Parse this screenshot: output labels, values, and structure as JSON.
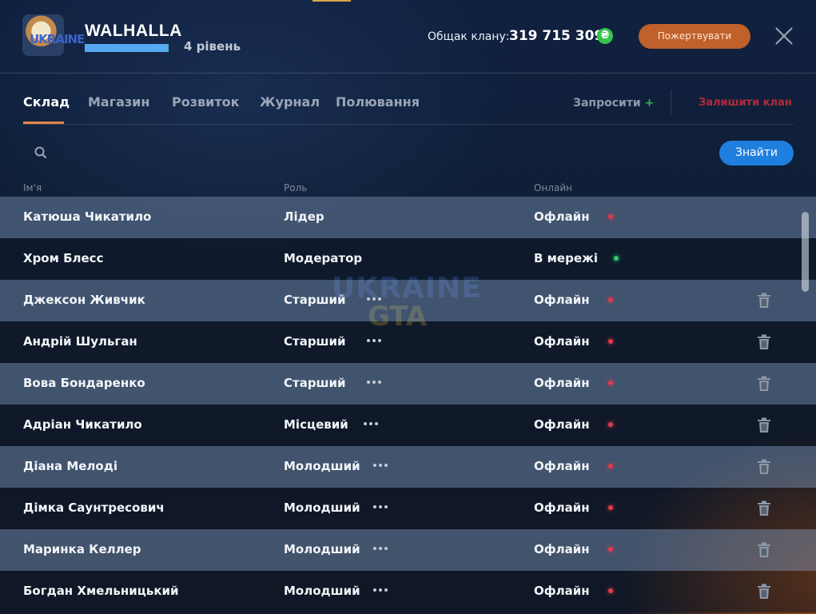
{
  "header": {
    "clan_name": "WALHALLA",
    "level_text": "4 рівень",
    "level_progress_percent": 94,
    "bank_label": "Общак клану:",
    "bank_value": "319 715 309",
    "currency_symbol": "₴",
    "donate_label": "Пожертвувати"
  },
  "tabs": [
    {
      "label": "Склад",
      "active": true
    },
    {
      "label": "Магазин",
      "active": false
    },
    {
      "label": "Розвиток",
      "active": false
    },
    {
      "label": "Журнал",
      "active": false
    },
    {
      "label": "Полювання",
      "active": false
    }
  ],
  "actions": {
    "invite_label": "Запросити",
    "invite_plus": "+",
    "leave_label": "Залишити клан"
  },
  "search": {
    "placeholder": "",
    "button_label": "Знайти"
  },
  "columns": {
    "name": "Ім'я",
    "role": "Роль",
    "online": "Онлайн"
  },
  "members": [
    {
      "name": "Катюша Чикатило",
      "role": "Лідер",
      "status": "Офлайн",
      "online": false,
      "has_menu": false,
      "removable": false
    },
    {
      "name": "Хром Блесс",
      "role": "Модератор",
      "status": "В мережі",
      "online": true,
      "has_menu": false,
      "removable": false
    },
    {
      "name": "Джексон Живчик",
      "role": "Старший",
      "status": "Офлайн",
      "online": false,
      "has_menu": true,
      "removable": true
    },
    {
      "name": "Андрій Шульган",
      "role": "Старший",
      "status": "Офлайн",
      "online": false,
      "has_menu": true,
      "removable": true
    },
    {
      "name": "Вова Бондаренко",
      "role": "Старший",
      "status": "Офлайн",
      "online": false,
      "has_menu": true,
      "removable": true
    },
    {
      "name": "Адріан Чикатило",
      "role": "Місцевий",
      "status": "Офлайн",
      "online": false,
      "has_menu": true,
      "removable": true
    },
    {
      "name": "Діана Мелоді",
      "role": "Молодший",
      "status": "Офлайн",
      "online": false,
      "has_menu": true,
      "removable": true
    },
    {
      "name": "Дімка Саунтресович",
      "role": "Молодший",
      "status": "Офлайн",
      "online": false,
      "has_menu": true,
      "removable": true
    },
    {
      "name": "Маринка Келлер",
      "role": "Молодший",
      "status": "Офлайн",
      "online": false,
      "has_menu": true,
      "removable": true
    },
    {
      "name": "Богдан Хмельницький",
      "role": "Молодший",
      "status": "Офлайн",
      "online": false,
      "has_menu": true,
      "removable": true
    }
  ],
  "watermark": {
    "line1": "UKRAINE",
    "line2": "GTA"
  },
  "colors": {
    "accent_tab": "#e4844a",
    "find_button": "#1f7fde",
    "donate_button": "#c0602a",
    "online_dot": "#2fcf6a",
    "offline_dot": "#e23a4a",
    "leave_text": "#b42a3a",
    "invite_plus": "#31b54a"
  },
  "icons": {
    "close": "close-icon",
    "search": "search-icon",
    "coin": "hryvnia-coin-icon",
    "menu": "dots-icon",
    "trash": "trash-icon"
  }
}
